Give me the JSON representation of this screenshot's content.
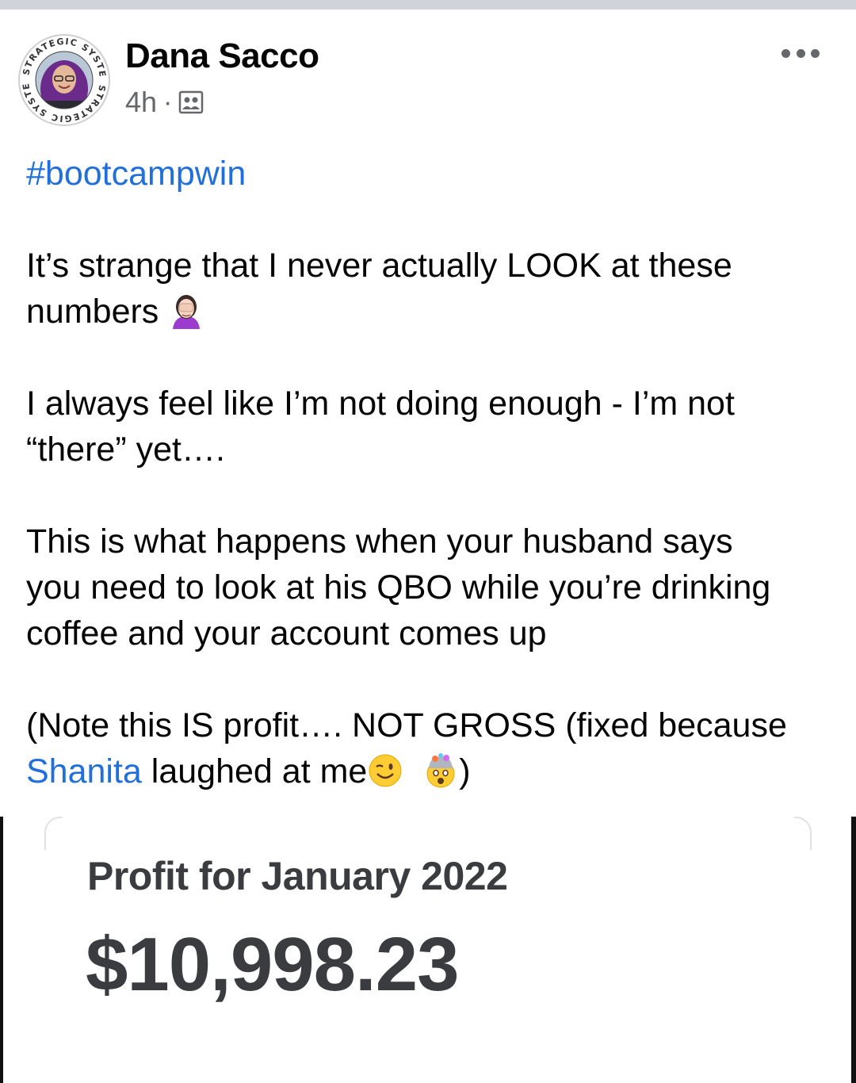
{
  "post": {
    "author_name": "Dana Sacco",
    "timestamp": "4h",
    "separator": "·",
    "audience_icon": "group-icon",
    "hashtag": "#bootcampwin",
    "paragraphs": {
      "p1_line1": "It’s strange that I never actually LOOK at these",
      "p1_line2": "numbers",
      "p2_line1": "I always feel like I’m not doing enough - I’m not",
      "p2_line2": "“there” yet….",
      "p3_line1": "This is what happens when your husband says",
      "p3_line2": "you need to look at his QBO while you’re drinking",
      "p3_line3": "coffee and your account comes up",
      "p4_line1": "(Note this IS profit…. NOT GROSS (fixed because",
      "p4_mention": "Shanita",
      "p4_line2_rest": " laughed at me",
      "p4_close": ")"
    },
    "emojis": {
      "facepalm": "woman-facepalming-emoji",
      "wink": "winking-face-emoji",
      "mindblown": "exploding-head-emoji"
    }
  },
  "avatar": {
    "ring_text_top": "SYSTEMS",
    "ring_text_left": "STRATEGIC",
    "ring_text_right": "STRATEGIC",
    "ring_text_bottom": "SYSTEMS"
  },
  "attachment": {
    "label": "Profit for January 2022",
    "amount": "$10,998.23"
  },
  "colors": {
    "link": "#216fdb",
    "meta": "#65676b",
    "card_text": "#3a3c40"
  }
}
